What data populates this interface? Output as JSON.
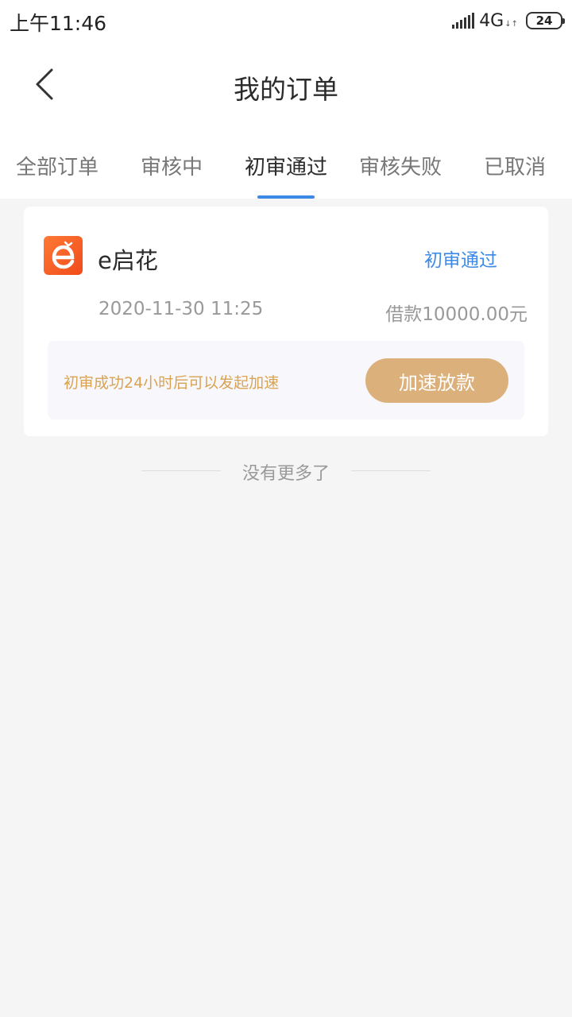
{
  "status_bar": {
    "time": "上午11:46",
    "network": "4G",
    "network_arrows": "↓↑",
    "battery": "24"
  },
  "header": {
    "title": "我的订单",
    "back_icon": "chevron-left-icon"
  },
  "tabs": [
    {
      "label": "全部订单",
      "active": false
    },
    {
      "label": "审核中",
      "active": false
    },
    {
      "label": "初审通过",
      "active": true
    },
    {
      "label": "审核失败",
      "active": false
    },
    {
      "label": "已取消",
      "active": false
    }
  ],
  "orders": [
    {
      "app_name": "e启花",
      "status": "初审通过",
      "time": "2020-11-30 11:25",
      "amount": "借款10000.00元",
      "tip": "初审成功24小时后可以发起加速",
      "action": "加速放款"
    }
  ],
  "footer": {
    "no_more": "没有更多了"
  },
  "colors": {
    "accent_blue": "#3d8ae6",
    "gold_button": "#dcb07a",
    "tip_text": "#d9a352",
    "logo_orange": "#f04a1a"
  }
}
